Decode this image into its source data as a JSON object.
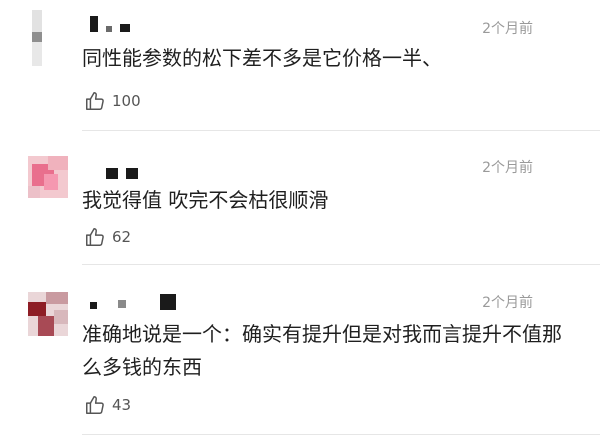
{
  "comments": [
    {
      "time": "2个月前",
      "text": "同性能参数的松下差不多是它价格一半、",
      "likes": "100"
    },
    {
      "time": "2个月前",
      "text": "我觉得值 吹完不会枯很顺滑",
      "likes": "62"
    },
    {
      "time": "2个月前",
      "text": "准确地说是一个：确实有提升但是对我而言提升不值那么多钱的东西",
      "likes": "43"
    }
  ],
  "icons": {
    "like": "thumbs-up-icon"
  },
  "colors": {
    "text": "#1f1f1f",
    "meta": "#9a9a9a",
    "divider": "#e6e6e6"
  }
}
